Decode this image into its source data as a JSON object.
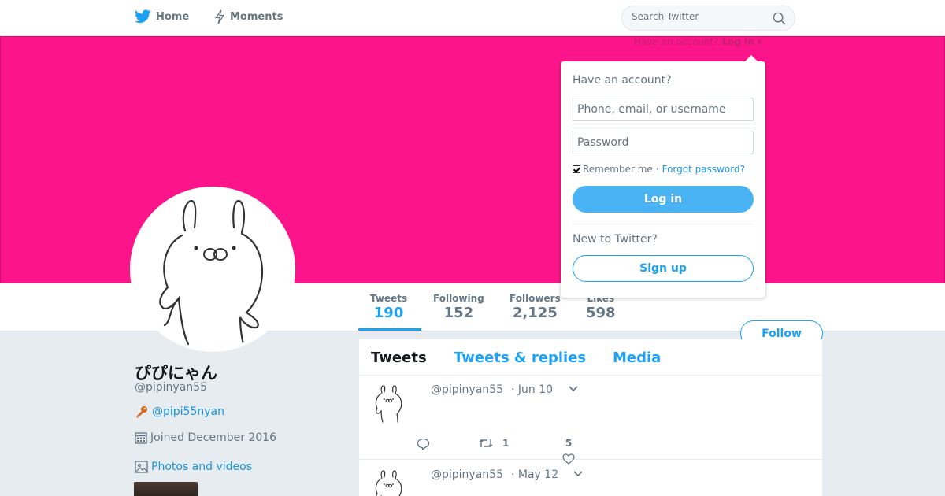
{
  "nav": {
    "home_label": "Home",
    "moments_label": "Moments",
    "search_placeholder": "Search Twitter"
  },
  "login_trigger": {
    "prefix": "Have an account?",
    "link": "Log in",
    "caret": "▾"
  },
  "profile": {
    "name": "ぴぴにゃん",
    "handle": "@pipinyan55",
    "link_icon": "key-icon",
    "link_text": "@pipi55nyan",
    "joined": "Joined December 2016",
    "photos_label": "Photos and videos"
  },
  "stats": [
    {
      "label": "Tweets",
      "value": "190"
    },
    {
      "label": "Following",
      "value": "152"
    },
    {
      "label": "Followers",
      "value": "2,125"
    },
    {
      "label": "Likes",
      "value": "598"
    }
  ],
  "follow_label": "Follow",
  "timeline": {
    "tabs": [
      "Tweets",
      "Tweets & replies",
      "Media"
    ],
    "tweets": [
      {
        "handle": "@pipinyan55",
        "time": "· Jun 10",
        "retweets": "1",
        "likes": "5"
      },
      {
        "handle": "@pipinyan55",
        "time": "· May 12"
      }
    ]
  },
  "login_dropdown": {
    "heading": "Have an account?",
    "username_placeholder": "Phone, email, or username",
    "password_placeholder": "Password",
    "remember_label": "Remember me",
    "separator": "·",
    "forgot_label": "Forgot password?",
    "login_button": "Log in",
    "new_heading": "New to Twitter?",
    "signup_button": "Sign up"
  },
  "colors": {
    "banner": "#fc158a",
    "accent": "#1da1f2",
    "background": "#e6ecf0"
  }
}
